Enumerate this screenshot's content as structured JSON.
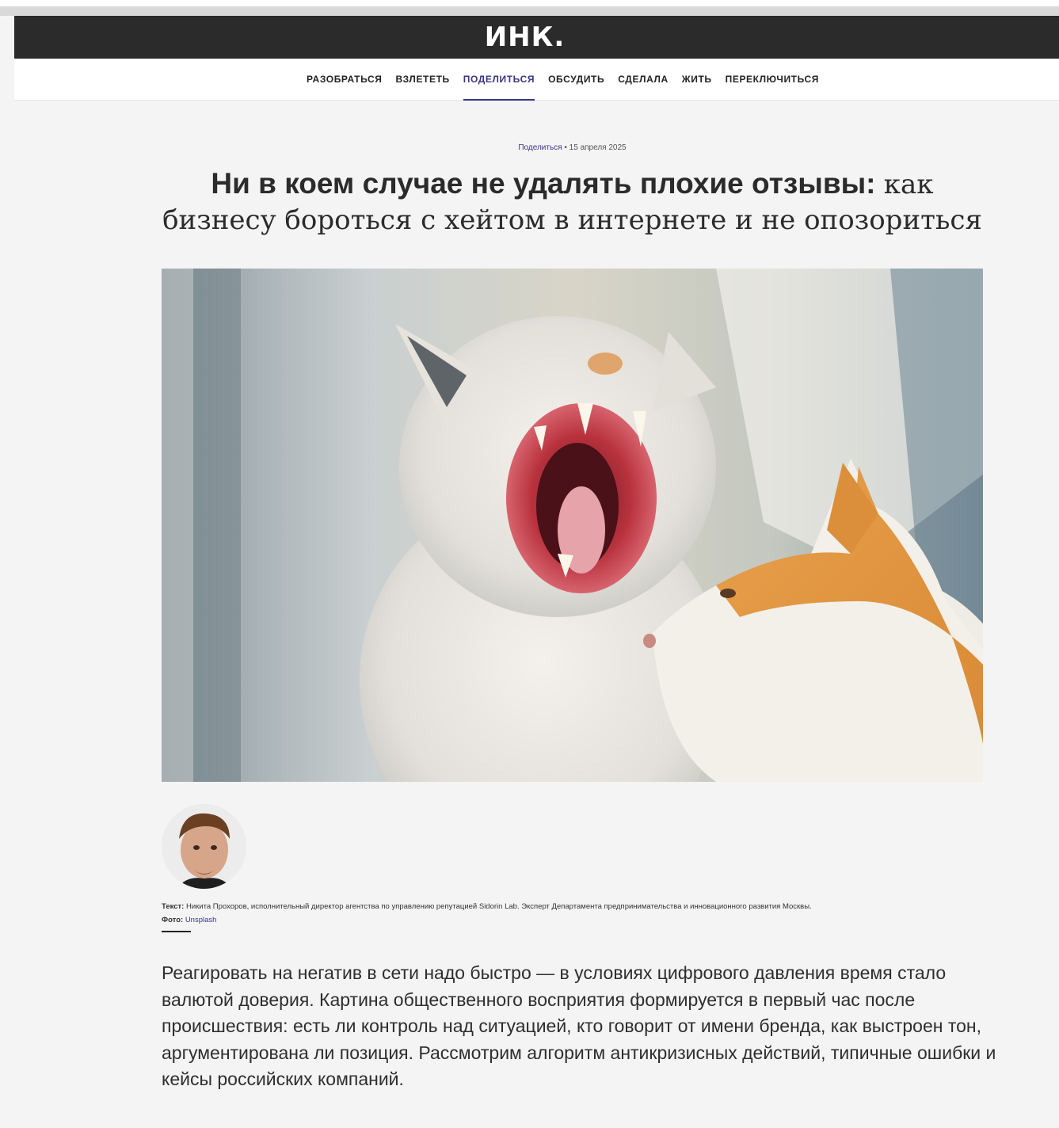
{
  "site": {
    "logo": "ИНК."
  },
  "nav": {
    "items": [
      {
        "label": "РАЗОБРАТЬСЯ",
        "active": false
      },
      {
        "label": "ВЗЛЕТЕТЬ",
        "active": false
      },
      {
        "label": "ПОДЕЛИТЬСЯ",
        "active": true
      },
      {
        "label": "ОБСУДИТЬ",
        "active": false
      },
      {
        "label": "СДЕЛАЛА",
        "active": false
      },
      {
        "label": "ЖИТЬ",
        "active": false
      },
      {
        "label": "ПЕРЕКЛЮЧИТЬСЯ",
        "active": false
      }
    ]
  },
  "article": {
    "category": "Поделиться",
    "separator": "•",
    "date": "15 апреля 2025",
    "title_bold": "Ни в коем случае не удалять плохие отзывы:",
    "title_regular": "как бизнесу бороться с хейтом в интернете и не опозориться",
    "credits": {
      "text_label": "Текст:",
      "text_value": "Никита Прохоров, исполнительный директор агентства по управлению репутацией Sidorin Lab. Эксперт Департамента предпринимательства и инновационного развития Москвы.",
      "photo_label": "Фото:",
      "photo_value": "Unsplash"
    },
    "lead": "Реагировать на негатив в сети надо быстро — в условиях цифрового давления время стало валютой доверия. Картина общественного восприятия формируется в первый час после происшествия: есть ли контроль над ситуацией, кто говорит от имени бренда, как выстроен тон, аргументирована ли позиция. Рассмотрим алгоритм антикризисных действий, типичные ошибки и кейсы российских компаний."
  },
  "colors": {
    "header_bg": "#2b2b2b",
    "accent": "#3a3784",
    "page_bg": "#f4f4f4"
  }
}
